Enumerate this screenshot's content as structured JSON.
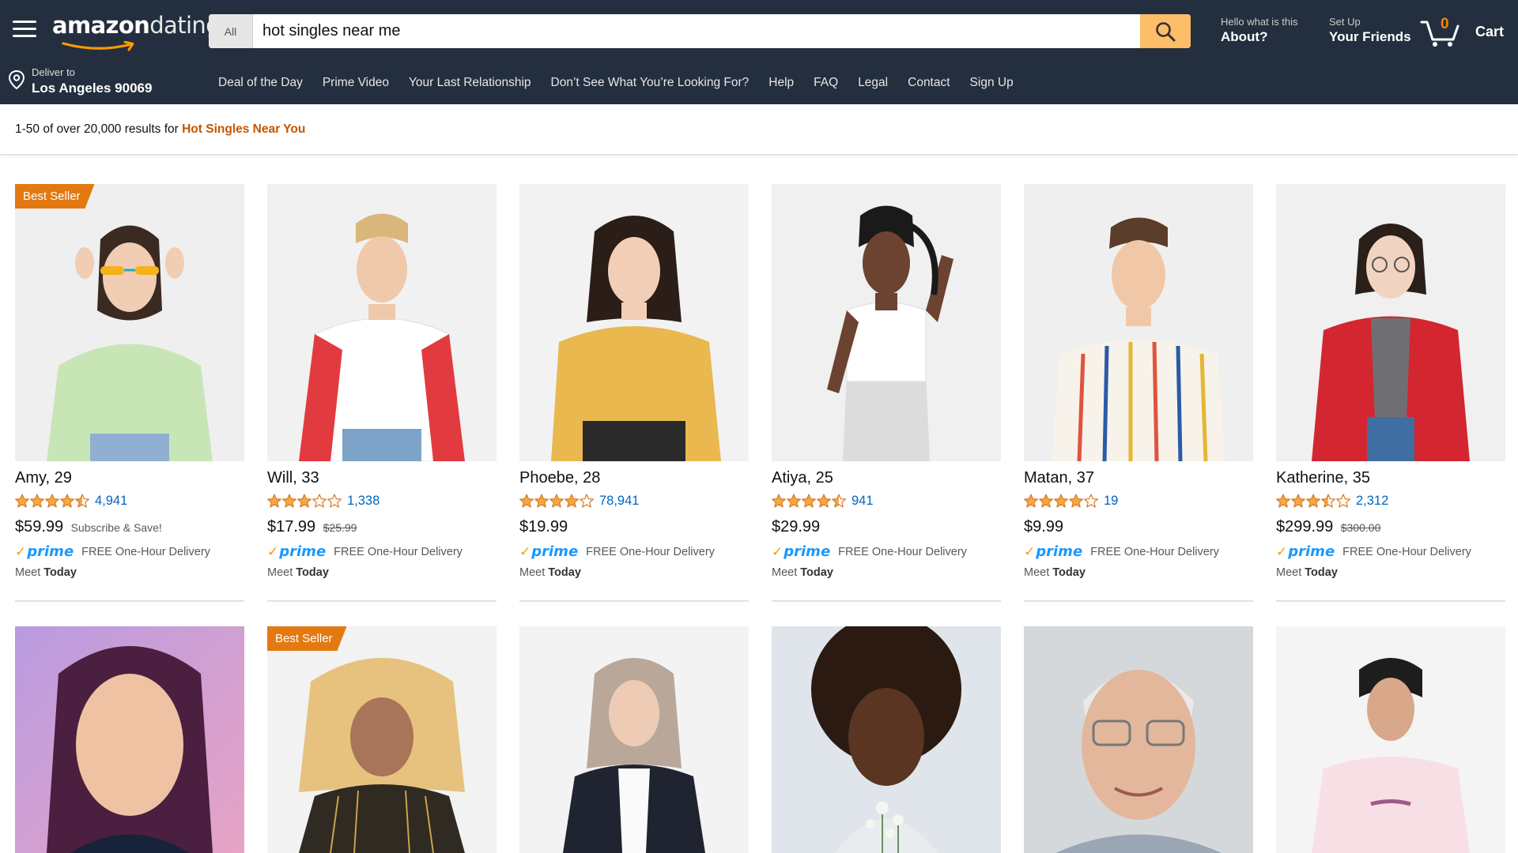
{
  "header": {
    "logo": {
      "bold": "amazon",
      "light": "dating"
    },
    "search": {
      "category": "All",
      "value": "hot singles near me"
    },
    "about": {
      "small": "Hello what is this",
      "big": "About?"
    },
    "friends": {
      "small": "Set Up",
      "big": "Your Friends"
    },
    "cart": {
      "count": "0",
      "label": "Cart"
    },
    "deliver": {
      "small": "Deliver to",
      "big": "Los Angeles 90069"
    },
    "nav": [
      "Deal of the Day",
      "Prime Video",
      "Your Last Relationship",
      "Don’t See What You’re Looking For?",
      "Help",
      "FAQ",
      "Legal",
      "Contact",
      "Sign Up"
    ]
  },
  "results": {
    "summary": "1-50 of over 20,000 results for",
    "query": "Hot Singles Near You"
  },
  "colors": {
    "header_bg": "#232f3e",
    "search_button": "#febd69",
    "badge": "#e47911",
    "link": "#0066c0",
    "star": "#f3a847",
    "cart_count": "#f08804"
  },
  "products": [
    {
      "name": "Amy, 29",
      "rating": 4.5,
      "reviews": "4,941",
      "price": "$59.99",
      "old_price": "",
      "subscribe": "Subscribe & Save!",
      "badge": "Best Seller",
      "prime": "prime",
      "delivery": "FREE One-Hour Delivery",
      "meet_label": "Meet",
      "meet_when": "Today"
    },
    {
      "name": "Will, 33",
      "rating": 3,
      "reviews": "1,338",
      "price": "$17.99",
      "old_price": "$25.99",
      "subscribe": "",
      "badge": "",
      "prime": "prime",
      "delivery": "FREE One-Hour Delivery",
      "meet_label": "Meet",
      "meet_when": "Today"
    },
    {
      "name": "Phoebe, 28",
      "rating": 4,
      "reviews": "78,941",
      "price": "$19.99",
      "old_price": "",
      "subscribe": "",
      "badge": "",
      "prime": "prime",
      "delivery": "FREE One-Hour Delivery",
      "meet_label": "Meet",
      "meet_when": "Today"
    },
    {
      "name": "Atiya, 25",
      "rating": 4.5,
      "reviews": "941",
      "price": "$29.99",
      "old_price": "",
      "subscribe": "",
      "badge": "",
      "prime": "prime",
      "delivery": "FREE One-Hour Delivery",
      "meet_label": "Meet",
      "meet_when": "Today"
    },
    {
      "name": "Matan, 37",
      "rating": 4,
      "reviews": "19",
      "price": "$9.99",
      "old_price": "",
      "subscribe": "",
      "badge": "",
      "prime": "prime",
      "delivery": "FREE One-Hour Delivery",
      "meet_label": "Meet",
      "meet_when": "Today"
    },
    {
      "name": "Katherine, 35",
      "rating": 3.5,
      "reviews": "2,312",
      "price": "$299.99",
      "old_price": "$300.00",
      "subscribe": "",
      "badge": "",
      "prime": "prime",
      "delivery": "FREE One-Hour Delivery",
      "meet_label": "Meet",
      "meet_when": "Today"
    },
    {
      "badge": ""
    },
    {
      "badge": "Best Seller"
    },
    {
      "badge": ""
    },
    {
      "badge": ""
    },
    {
      "badge": ""
    },
    {
      "badge": ""
    }
  ]
}
